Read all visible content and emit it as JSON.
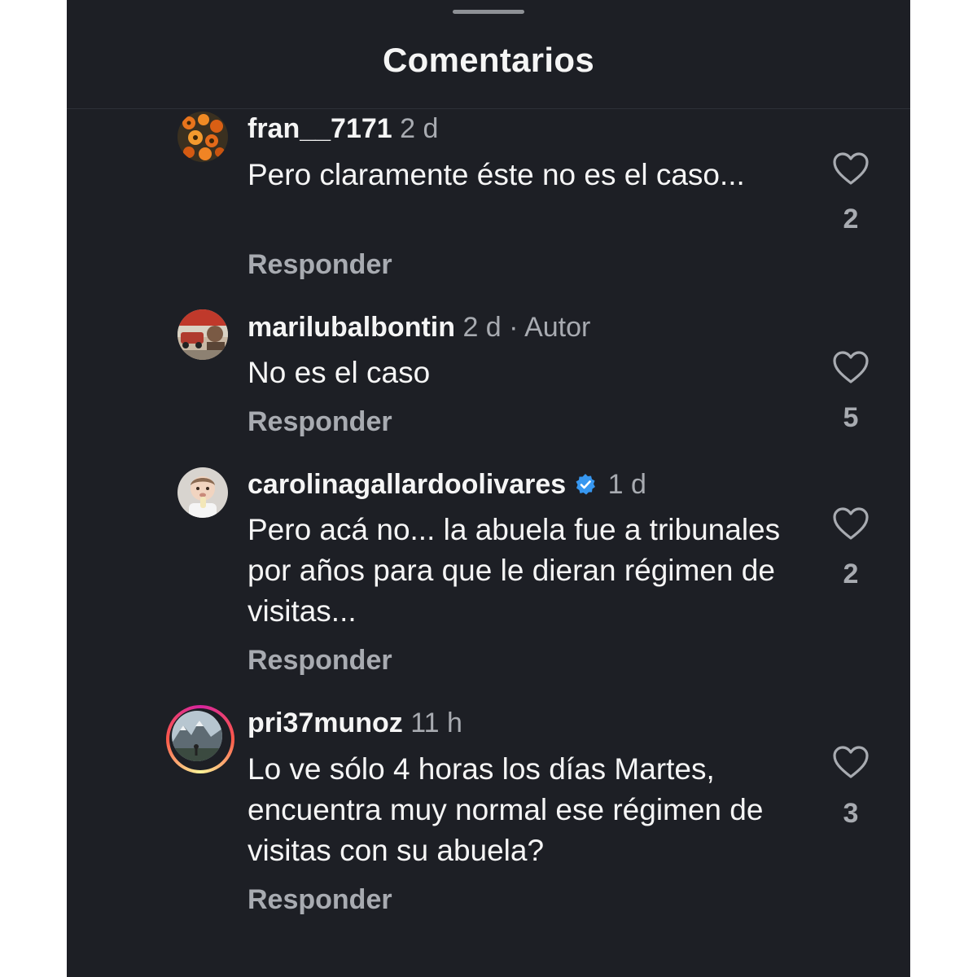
{
  "header": {
    "title": "Comentarios"
  },
  "comments": [
    {
      "username": "fran__7171",
      "time": "2 d",
      "text": "Pero claramente éste no es el caso...",
      "reply_label": "Responder",
      "likes": "2",
      "avatar_icon": "orange-flowers-avatar"
    },
    {
      "username": "marilubalbontin",
      "time": "2 d",
      "separator": "·",
      "author_label": "Autor",
      "text": "No es el caso",
      "reply_label": "Responder",
      "likes": "5",
      "avatar_icon": "vintage-photo-avatar"
    },
    {
      "username": "carolinagallardoolivares",
      "verified": true,
      "time": "1 d",
      "text": "Pero acá no... la abuela fue a tribunales por años para que le dieran régimen de visitas...",
      "reply_label": "Responder",
      "likes": "2",
      "avatar_icon": "baby-photo-avatar"
    },
    {
      "username": "pri37munoz",
      "has_story": true,
      "time": "11 h",
      "text": "Lo ve sólo 4 horas los días Martes, encuentra muy normal ese régimen de visitas con su abuela?",
      "reply_label": "Responder",
      "likes": "3",
      "avatar_icon": "mountain-landscape-avatar"
    }
  ],
  "colors": {
    "background": "#1d1f25",
    "primary_text": "#f5f5f5",
    "secondary_text": "#a8abb1",
    "verified_badge": "#3797f0"
  }
}
